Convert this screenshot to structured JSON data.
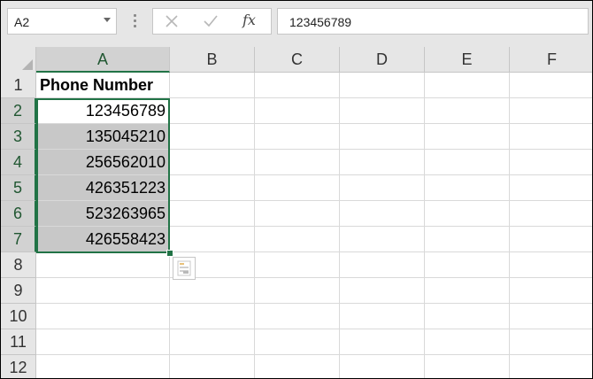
{
  "name_box": {
    "value": "A2"
  },
  "formula_bar": {
    "fx_label": "fx",
    "value": "123456789"
  },
  "columns": [
    "A",
    "B",
    "C",
    "D",
    "E",
    "F"
  ],
  "rows": [
    "1",
    "2",
    "3",
    "4",
    "5",
    "6",
    "7",
    "8",
    "9",
    "10",
    "11",
    "12"
  ],
  "cells": {
    "A1": "Phone Number",
    "A2": "123456789",
    "A3": "135045210",
    "A4": "256562010",
    "A5": "426351223",
    "A6": "523263965",
    "A7": "426558423"
  },
  "selection": {
    "range": "A2:A7",
    "active_cell": "A2"
  },
  "colors": {
    "accent": "#217346",
    "header_bg": "#e6e6e6",
    "selected_header_bg": "#d2d2d2",
    "selection_fill": "#c8c8c8"
  }
}
